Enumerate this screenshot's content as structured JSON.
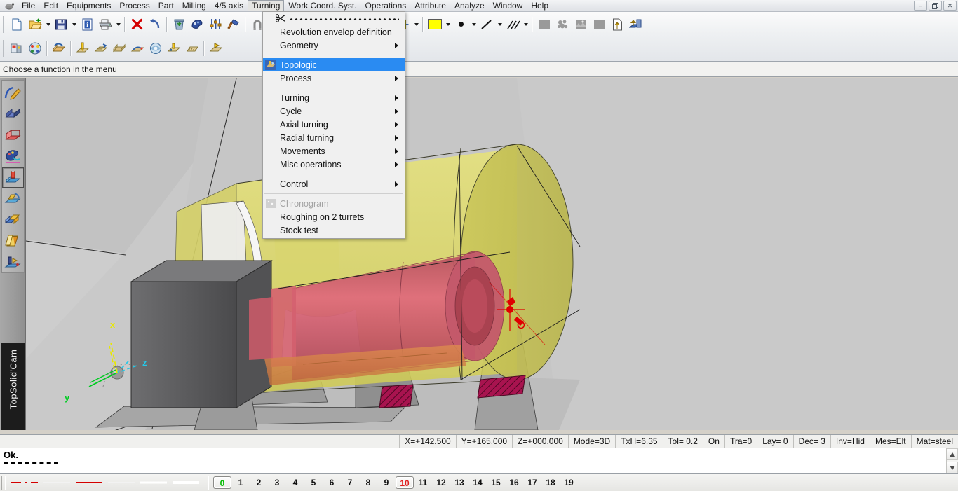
{
  "window": {
    "app_icon": "topsolid-logo-icon",
    "controls": {
      "minimize": "–",
      "restore": "❐",
      "close": "✕"
    }
  },
  "menubar": {
    "items": [
      {
        "label": "File",
        "active": false
      },
      {
        "label": "Edit",
        "active": false
      },
      {
        "label": "Equipments",
        "active": false
      },
      {
        "label": "Process",
        "active": false
      },
      {
        "label": "Part",
        "active": false
      },
      {
        "label": "Milling",
        "active": false
      },
      {
        "label": "4/5 axis",
        "active": false
      },
      {
        "label": "Turning",
        "active": true
      },
      {
        "label": "Work Coord. Syst.",
        "active": false
      },
      {
        "label": "Operations",
        "active": false
      },
      {
        "label": "Attribute",
        "active": false
      },
      {
        "label": "Analyze",
        "active": false
      },
      {
        "label": "Window",
        "active": false
      },
      {
        "label": "Help",
        "active": false
      }
    ]
  },
  "dropdown": {
    "owner": "Turning",
    "tearoff_icon": "scissors-icon",
    "items": [
      {
        "label": "Revolution envelop definition",
        "submenu": false,
        "highlighted": false,
        "disabled": false,
        "icon": null
      },
      {
        "label": "Geometry",
        "submenu": true,
        "highlighted": false,
        "disabled": false,
        "icon": null
      },
      {
        "separator": true
      },
      {
        "label": "Topologic",
        "submenu": false,
        "highlighted": true,
        "disabled": false,
        "icon": "topologic-icon"
      },
      {
        "label": "Process",
        "submenu": true,
        "highlighted": false,
        "disabled": false,
        "icon": null
      },
      {
        "separator": true
      },
      {
        "label": "Turning",
        "submenu": true,
        "highlighted": false,
        "disabled": false,
        "icon": null
      },
      {
        "label": "Cycle",
        "submenu": true,
        "highlighted": false,
        "disabled": false,
        "icon": null
      },
      {
        "label": "Axial turning",
        "submenu": true,
        "highlighted": false,
        "disabled": false,
        "icon": null
      },
      {
        "label": "Radial turning",
        "submenu": true,
        "highlighted": false,
        "disabled": false,
        "icon": null
      },
      {
        "label": "Movements",
        "submenu": true,
        "highlighted": false,
        "disabled": false,
        "icon": null
      },
      {
        "label": "Misc operations",
        "submenu": true,
        "highlighted": false,
        "disabled": false,
        "icon": null
      },
      {
        "separator": true
      },
      {
        "label": "Control",
        "submenu": true,
        "highlighted": false,
        "disabled": false,
        "icon": null
      },
      {
        "separator": true
      },
      {
        "label": "Chronogram",
        "submenu": false,
        "highlighted": false,
        "disabled": true,
        "icon": "chronogram-icon"
      },
      {
        "label": "Roughing on 2 turrets",
        "submenu": false,
        "highlighted": false,
        "disabled": false,
        "icon": null
      },
      {
        "label": "Stock test",
        "submenu": false,
        "highlighted": false,
        "disabled": false,
        "icon": null
      }
    ]
  },
  "toolbar_row1": [
    {
      "name": "new-document-icon",
      "type": "icon"
    },
    {
      "name": "open-document-icon",
      "type": "icon"
    },
    {
      "name": "open-dropdown-caret",
      "type": "caret"
    },
    {
      "name": "save-icon",
      "type": "icon"
    },
    {
      "name": "save-dropdown-caret",
      "type": "caret"
    },
    {
      "name": "document-info-icon",
      "type": "icon"
    },
    {
      "name": "print-icon",
      "type": "icon"
    },
    {
      "name": "print-dropdown-caret",
      "type": "caret"
    },
    {
      "name": "separator",
      "type": "sep"
    },
    {
      "name": "delete-icon",
      "type": "icon"
    },
    {
      "name": "undo-icon",
      "type": "icon"
    },
    {
      "name": "separator",
      "type": "sep"
    },
    {
      "name": "recycle-bin-icon",
      "type": "icon"
    },
    {
      "name": "paint-icon",
      "type": "icon"
    },
    {
      "name": "parameters-icon",
      "type": "icon"
    },
    {
      "name": "hammer-icon",
      "type": "icon"
    },
    {
      "name": "separator",
      "type": "sep"
    },
    {
      "name": "magnet-icon",
      "type": "icon"
    },
    {
      "name": "construction-icon",
      "type": "icon"
    },
    {
      "name": "construction-dropdown-caret",
      "type": "caret"
    },
    {
      "name": "separator",
      "type": "sep"
    },
    {
      "name": "zoom-icon",
      "type": "icon"
    },
    {
      "name": "zoom-dropdown-caret",
      "type": "caret"
    },
    {
      "name": "fit-view-icon",
      "type": "icon"
    },
    {
      "name": "view-orientation-icon",
      "type": "icon"
    },
    {
      "name": "view-dropdown-caret",
      "type": "caret"
    },
    {
      "name": "glasses-visibility-icon",
      "type": "icon"
    },
    {
      "name": "glasses-dropdown-caret",
      "type": "caret"
    },
    {
      "name": "cylinder-rotate-icon",
      "type": "icon"
    },
    {
      "name": "cylinder-dropdown-caret",
      "type": "caret"
    },
    {
      "name": "separator",
      "type": "sep"
    },
    {
      "name": "color-swatch",
      "type": "swatch"
    },
    {
      "name": "color-dropdown-caret",
      "type": "caret"
    },
    {
      "name": "point-style-icon",
      "type": "dot"
    },
    {
      "name": "point-dropdown-caret",
      "type": "caret"
    },
    {
      "name": "line-style-icon",
      "type": "icon"
    },
    {
      "name": "line-dropdown-caret",
      "type": "caret"
    },
    {
      "name": "hatch-style-icon",
      "type": "icon"
    },
    {
      "name": "hatch-dropdown-caret",
      "type": "caret"
    },
    {
      "name": "separator",
      "type": "sep"
    },
    {
      "name": "shade-solid-icon",
      "type": "icon"
    },
    {
      "name": "shade-textured-icon",
      "type": "icon"
    },
    {
      "name": "shade-mixed-icon",
      "type": "icon"
    },
    {
      "name": "shade-flat-icon",
      "type": "icon"
    },
    {
      "name": "export-document-icon",
      "type": "icon"
    },
    {
      "name": "publish-icon",
      "type": "icon"
    }
  ],
  "toolbar_row2": [
    {
      "name": "machine-setup-icon"
    },
    {
      "name": "tool-palette-icon"
    },
    {
      "name": "separator-a"
    },
    {
      "name": "stock-icon"
    },
    {
      "name": "separator-b"
    },
    {
      "name": "drilling-op-icon"
    },
    {
      "name": "pocket-op-icon"
    },
    {
      "name": "face-op-icon"
    },
    {
      "name": "contour-op-icon"
    },
    {
      "name": "surface-op-icon"
    },
    {
      "name": "groove-op-icon"
    },
    {
      "name": "thread-op-icon"
    },
    {
      "name": "separator-c"
    },
    {
      "name": "simulate-icon"
    }
  ],
  "prompt": {
    "text": "Choose a function in the menu"
  },
  "left_toolbar": {
    "items": [
      {
        "name": "sketch-icon",
        "selected": false
      },
      {
        "name": "solid-icon",
        "selected": false
      },
      {
        "name": "sheetmetal-icon",
        "selected": false
      },
      {
        "name": "attribute-palette-icon",
        "selected": false
      },
      {
        "name": "machining-icon",
        "selected": true
      },
      {
        "name": "tooling-icon",
        "selected": false
      },
      {
        "name": "assembly-icon",
        "selected": false
      },
      {
        "name": "drafting-icon",
        "selected": false
      },
      {
        "name": "simulation-icon",
        "selected": false
      }
    ],
    "brand": "TopSolid'Cam"
  },
  "viewport": {
    "axis_indicator": {
      "x_label": "x",
      "y_label": "y",
      "z_label": "z",
      "x_color": "#e8e800",
      "y_color": "#00cc22",
      "z_color": "#25c8e8"
    },
    "colors": {
      "background": "#c9c9c9",
      "stock_yellow": "#dcd96a",
      "part_red": "#d9566a",
      "chuck_gray": "#58585a",
      "hatch_magenta": "#b4145a",
      "marker_red": "#e00000"
    }
  },
  "statusbar": {
    "cells": [
      "X=+142.500",
      "Y=+165.000",
      "Z=+000.000",
      "Mode=3D",
      "TxH=6.35",
      "Tol=  0.2",
      "On",
      "Tra=0",
      "Lay=  0",
      "Dec= 3",
      "Inv=Hid",
      "Mes=Elt",
      "Mat=steel"
    ]
  },
  "message_area": {
    "text": "Ok.",
    "scroll_up": "▲",
    "scroll_down": "▼"
  },
  "bottombar": {
    "line_styles": [
      {
        "name": "dash-dot-red",
        "color": "#d40000",
        "pattern": "14 5 4 5",
        "width": 2
      },
      {
        "name": "solid-white",
        "color": "#f2f2f2",
        "pattern": "0",
        "width": 2
      },
      {
        "name": "solid-red",
        "color": "#d40000",
        "pattern": "0",
        "width": 2
      },
      {
        "name": "thin-white",
        "color": "#f2f2f2",
        "pattern": "0",
        "width": 2
      },
      {
        "name": "medium-white",
        "color": "#ffffff",
        "pattern": "0",
        "width": 3
      },
      {
        "name": "thick-white",
        "color": "#ffffff",
        "pattern": "0",
        "width": 4
      }
    ],
    "layers": [
      {
        "n": "0",
        "color": "#00bb00",
        "boxed": true
      },
      {
        "n": "1",
        "color": "#111111",
        "boxed": false
      },
      {
        "n": "2",
        "color": "#111111",
        "boxed": false
      },
      {
        "n": "3",
        "color": "#111111",
        "boxed": false
      },
      {
        "n": "4",
        "color": "#111111",
        "boxed": false
      },
      {
        "n": "5",
        "color": "#111111",
        "boxed": false
      },
      {
        "n": "6",
        "color": "#111111",
        "boxed": false
      },
      {
        "n": "7",
        "color": "#111111",
        "boxed": false
      },
      {
        "n": "8",
        "color": "#111111",
        "boxed": false
      },
      {
        "n": "9",
        "color": "#111111",
        "boxed": false
      },
      {
        "n": "10",
        "color": "#e02020",
        "boxed": true
      },
      {
        "n": "11",
        "color": "#111111",
        "boxed": false
      },
      {
        "n": "12",
        "color": "#111111",
        "boxed": false
      },
      {
        "n": "13",
        "color": "#111111",
        "boxed": false
      },
      {
        "n": "14",
        "color": "#111111",
        "boxed": false
      },
      {
        "n": "15",
        "color": "#111111",
        "boxed": false
      },
      {
        "n": "16",
        "color": "#111111",
        "boxed": false
      },
      {
        "n": "17",
        "color": "#111111",
        "boxed": false
      },
      {
        "n": "18",
        "color": "#111111",
        "boxed": false
      },
      {
        "n": "19",
        "color": "#111111",
        "boxed": false
      }
    ]
  }
}
